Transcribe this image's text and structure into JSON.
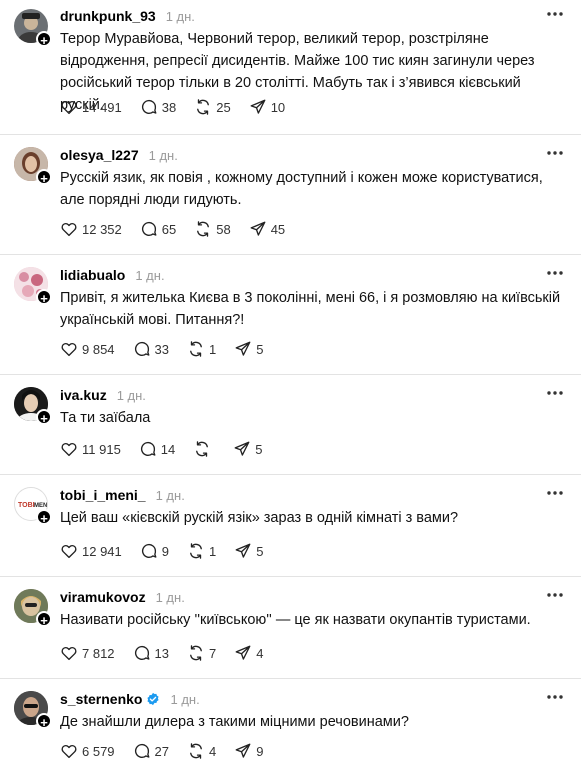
{
  "posts": [
    {
      "username": "drunkpunk_93",
      "time": "1 дн.",
      "text": "Терор Муравйова, Червоний терор, великий терор, розстріляне відродження, репресії дисидентів. Майже 100 тис киян загинули через російський терор тільки в 20 столітті. Мабуть так і з’явився кієвський рускій.",
      "likes": "14 491",
      "replies": "38",
      "reposts": "25",
      "shares": "10",
      "avatar_color": "#6b6f73",
      "verified": false
    },
    {
      "username": "olesya_l227",
      "time": "1 дн.",
      "text": "Русскій язик, як повія , кожному доступний і кожен може користуватися, але порядні люди гидують.",
      "likes": "12 352",
      "replies": "65",
      "reposts": "58",
      "shares": "45",
      "avatar_color": "#8a5a44",
      "verified": false
    },
    {
      "username": "lidiabualo",
      "time": "1 дн.",
      "text": "Привіт, я жителька Києва в 3 поколінні, мені 66, і я розмовляю на київській українській мові. Питання?!",
      "likes": "9 854",
      "replies": "33",
      "reposts": "1",
      "shares": "5",
      "avatar_color": "#e8b7c4",
      "verified": false
    },
    {
      "username": "iva.kuz",
      "time": "1 дн.",
      "text": "Та ти заїбала",
      "likes": "11 915",
      "replies": "14",
      "reposts": "",
      "shares": "5",
      "avatar_color": "#2a2a2a",
      "verified": false
    },
    {
      "username": "tobi_i_meni_",
      "time": "1 дн.",
      "text": "Цей ваш «кієвскій рускій язік» зараз в одній кімнаті з вами?",
      "likes": "12 941",
      "replies": "9",
      "reposts": "1",
      "shares": "5",
      "avatar_color": "#f2f2f2",
      "verified": false
    },
    {
      "username": "viramukovoz",
      "time": "1 дн.",
      "text": "Називати російську ''київською'' — це як назвати окупантів туристами.",
      "likes": "7 812",
      "replies": "13",
      "reposts": "7",
      "shares": "4",
      "avatar_color": "#7a6a4a",
      "verified": false
    },
    {
      "username": "s_sternenko",
      "time": "1 дн.",
      "text": "Де знайшли дилера з такими міцними речовинами?",
      "likes": "6 579",
      "replies": "27",
      "reposts": "4",
      "shares": "9",
      "avatar_color": "#3b3b3b",
      "verified": true
    }
  ],
  "colors": {
    "verified_blue": "#1d9bf0",
    "muted_text": "#9a9a9a",
    "divider": "#e3e3e3"
  }
}
